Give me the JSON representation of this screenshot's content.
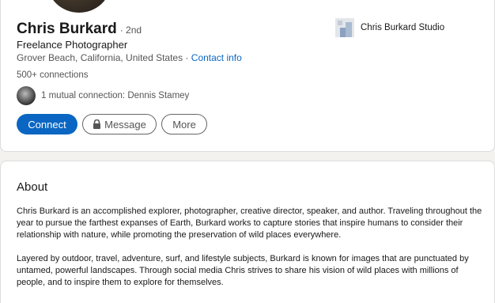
{
  "profile": {
    "name": "Chris Burkard",
    "degree": "· 2nd",
    "headline": "Freelance Photographer",
    "location": "Grover Beach, California, United States",
    "location_separator": " · ",
    "contact_info": "Contact info",
    "connections": "500+ connections",
    "mutual": "1 mutual connection: Dennis Stamey"
  },
  "actions": {
    "connect": "Connect",
    "message": "Message",
    "more": "More"
  },
  "company": {
    "name": "Chris Burkard Studio"
  },
  "about": {
    "title": "About",
    "p1": "Chris Burkard is an accomplished explorer, photographer, creative director, speaker, and author. Traveling throughout the year to pursue the farthest expanses of Earth, Burkard works to capture stories that inspire humans to consider their relationship with nature, while promoting the preservation of wild places everywhere.",
    "p2": "Layered by outdoor, travel, adventure, surf, and lifestyle subjects, Burkard is known for images that are punctuated by untamed, powerful landscapes. Through social media Chris strives to share his vision of wild places with millions of people, and to inspire them to explore for themselves."
  },
  "colors": {
    "accent": "#0a66c2",
    "background": "#f3f2ef"
  }
}
